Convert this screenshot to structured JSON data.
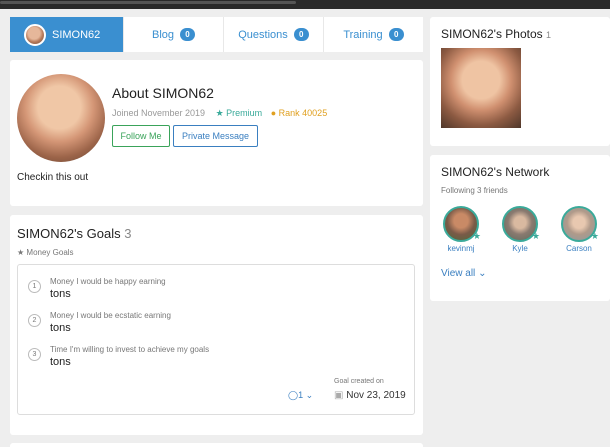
{
  "user": {
    "name": "SIMON62"
  },
  "tabs": [
    {
      "label": "SIMON62",
      "active": true
    },
    {
      "label": "Blog",
      "count": "0"
    },
    {
      "label": "Questions",
      "count": "0"
    },
    {
      "label": "Training",
      "count": "0"
    }
  ],
  "about": {
    "title": "About SIMON62",
    "joined": "Joined November 2019",
    "premium": "Premium",
    "rank": "Rank 40025",
    "follow_label": "Follow Me",
    "pm_label": "Private Message",
    "status": "Checkin this out"
  },
  "goals": {
    "title": "SIMON62's Goals",
    "count": "3",
    "category": "Money Goals",
    "items": [
      {
        "num": "1",
        "label": "Money I would be happy earning",
        "value": "tons"
      },
      {
        "num": "2",
        "label": "Money I would be ecstatic earning",
        "value": "tons"
      },
      {
        "num": "3",
        "label": "Time I'm willing to invest to achieve my goals",
        "value": "tons"
      }
    ],
    "comment_count": "1",
    "created_label": "Goal created on",
    "created_date": "Nov 23, 2019"
  },
  "photos": {
    "title": "SIMON62's Photos",
    "count": "1"
  },
  "network": {
    "title": "SIMON62's Network",
    "following": "Following 3 friends",
    "friends": [
      {
        "name": "kevinmj"
      },
      {
        "name": "Kyle"
      },
      {
        "name": "Carson"
      }
    ],
    "view_all": "View all"
  },
  "colors": {
    "accent": "#3a8fd0",
    "premium": "#3aaa9a",
    "rank": "#e0a020",
    "follow": "#3aa35a"
  }
}
